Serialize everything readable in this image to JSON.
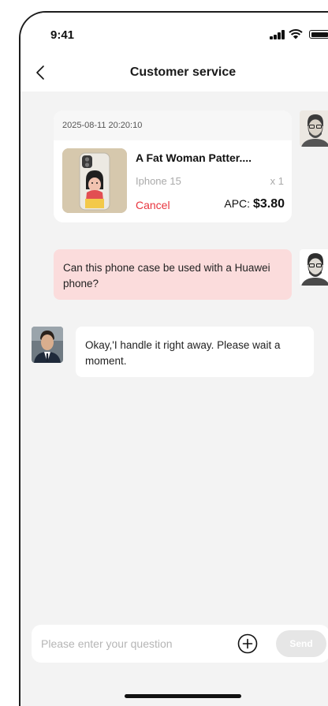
{
  "status_bar": {
    "time": "9:41"
  },
  "header": {
    "title": "Customer service"
  },
  "order": {
    "datetime": "2025-08-11 20:20:10",
    "product_name": "A Fat Woman Patter....",
    "model": "Iphone 15",
    "quantity": "x 1",
    "cancel_label": "Cancel",
    "apc_label": "APC: ",
    "apc_value": "$3.80"
  },
  "messages": [
    {
      "from": "user",
      "text": "Can this phone case be used with a Huawei phone?"
    },
    {
      "from": "agent",
      "text": "Okay,'I handle it right away. Please wait a moment."
    }
  ],
  "composer": {
    "placeholder": "Please enter your question",
    "send_label": "Send"
  },
  "colors": {
    "cancel": "#e8343e",
    "user_bubble": "#fbdcdc",
    "send_disabled": "#e6e6e6"
  }
}
